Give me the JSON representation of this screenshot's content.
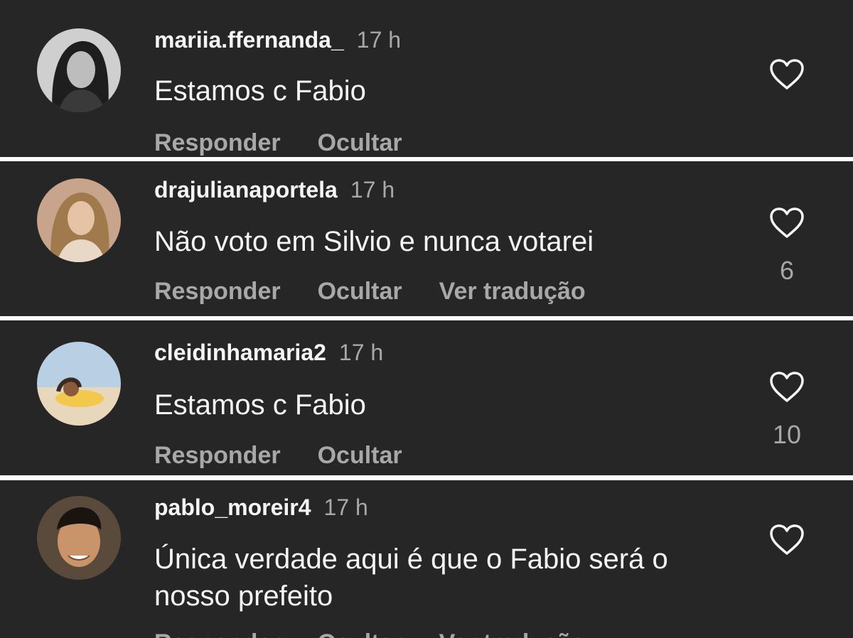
{
  "comments": [
    {
      "username": "mariia.ffernanda_",
      "time": "17 h",
      "text": "Estamos c Fabio",
      "actions": [
        "Responder",
        "Ocultar"
      ],
      "likes": "",
      "avatar_icon": "profile-photo"
    },
    {
      "username": "drajulianaportela",
      "time": "17 h",
      "text": "Não voto em Silvio e nunca votarei",
      "actions": [
        "Responder",
        "Ocultar",
        "Ver tradução"
      ],
      "likes": "6",
      "avatar_icon": "profile-photo"
    },
    {
      "username": "cleidinhamaria2",
      "time": "17 h",
      "text": "Estamos c Fabio",
      "actions": [
        "Responder",
        "Ocultar"
      ],
      "likes": "10",
      "avatar_icon": "profile-photo"
    },
    {
      "username": "pablo_moreir4",
      "time": "17 h",
      "text": "Única verdade aqui é que o Fabio será o nosso prefeito",
      "actions": [
        "Responder",
        "Ocultar",
        "Ver tradução"
      ],
      "likes": "",
      "avatar_icon": "profile-photo"
    }
  ],
  "icons": {
    "like": "heart-outline-icon"
  },
  "colors": {
    "background": "#262626",
    "separator": "#ffffff",
    "primary_text": "#f5f5f5",
    "secondary_text": "#a8a8a8"
  }
}
